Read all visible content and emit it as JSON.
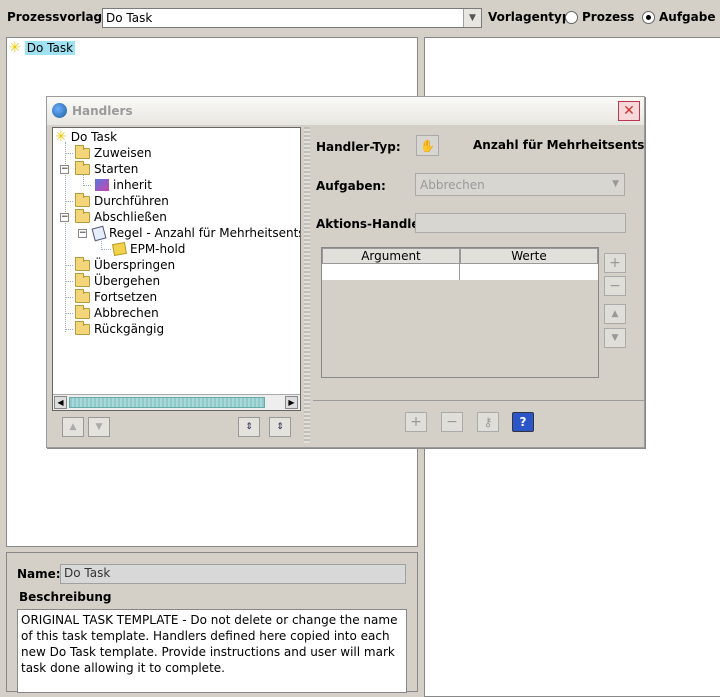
{
  "topbar": {
    "template_label": "Prozessvorlage",
    "template_value": "Do Task",
    "type_label": "Vorlagentyp",
    "radio_process": "Prozess",
    "radio_task": "Aufgabe",
    "selected": "Aufgabe"
  },
  "main_tree": {
    "root": "Do Task"
  },
  "details": {
    "name_label": "Name:",
    "name_value": "Do Task",
    "description_label": "Beschreibung",
    "description_text": "ORIGINAL TASK TEMPLATE - Do not delete or change the name of this task template.  Handlers defined here copied into each new Do Task template. Provide instructions and user will mark task done allowing it to complete."
  },
  "dialog": {
    "title": "Handlers",
    "tree": {
      "root": "Do Task",
      "items": [
        "Zuweisen",
        "Starten",
        "inherit",
        "Durchführen",
        "Abschließen",
        "Regel - Anzahl für Mehrheitsentsch",
        "EPM-hold",
        "Überspringen",
        "Übergehen",
        "Fortsetzen",
        "Abbrechen",
        "Rückgängig"
      ]
    },
    "handler_type_label": "Handler-Typ:",
    "handler_type_value": "Anzahl für Mehrheitsentscheid",
    "tasks_label": "Aufgaben:",
    "tasks_value": "Abbrechen",
    "action_handler_label": "Aktions-Handler:",
    "table_headers": [
      "Argument",
      "Werte"
    ]
  },
  "icons": {
    "star": "star-icon",
    "folder": "folder-icon",
    "close": "close-icon",
    "help": "help-icon",
    "key": "key-icon"
  }
}
